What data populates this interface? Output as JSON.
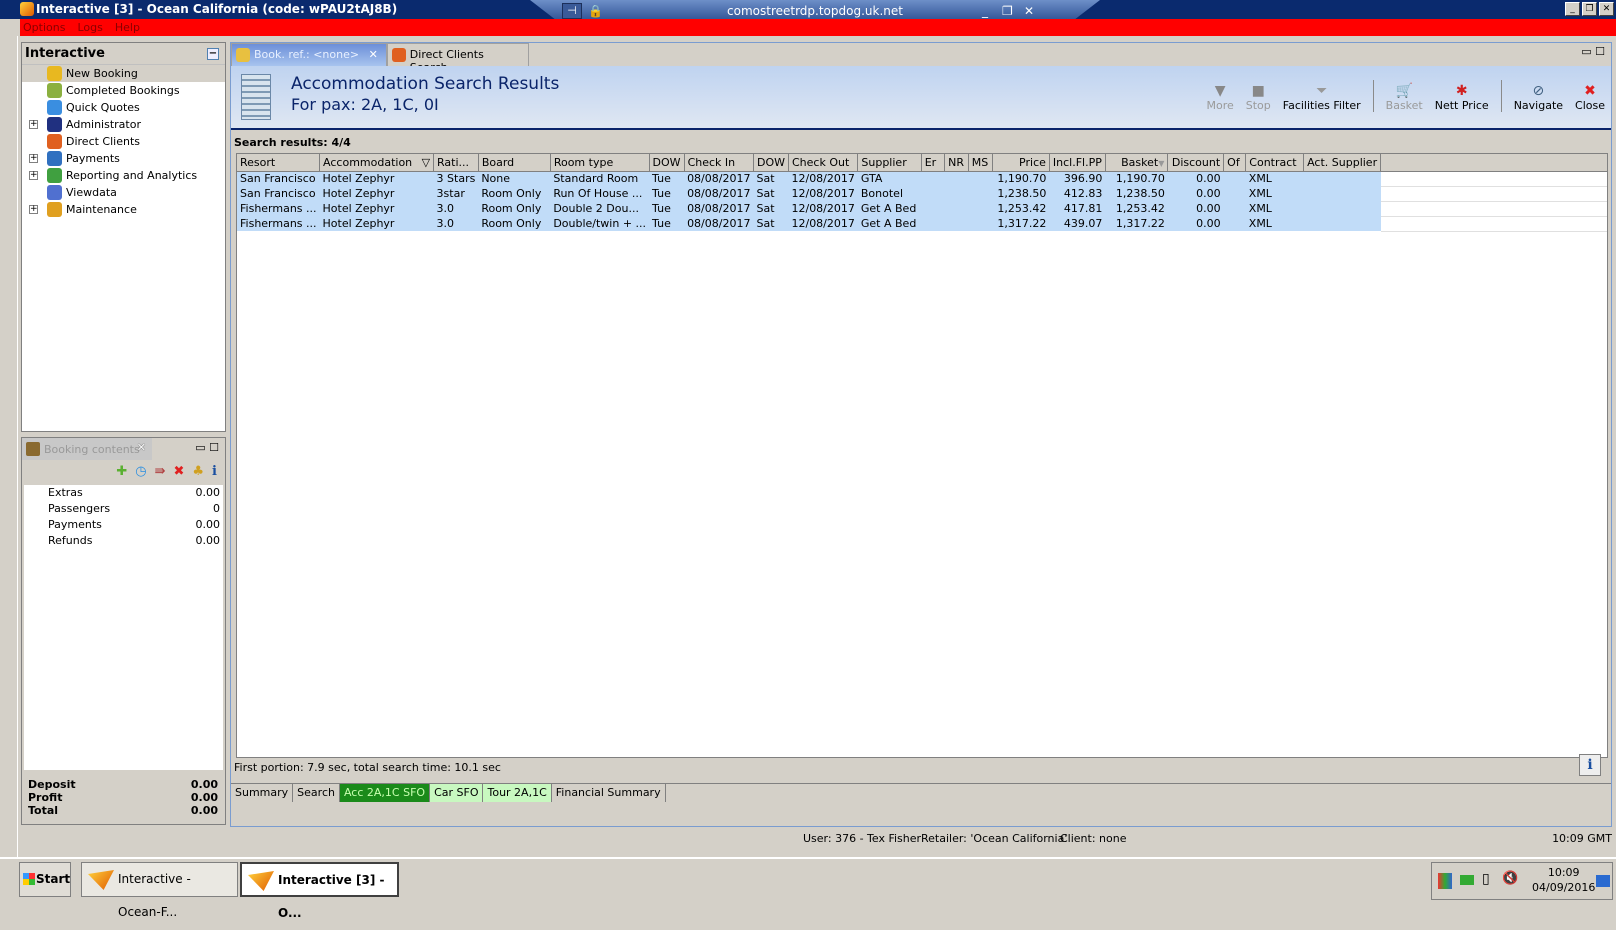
{
  "window": {
    "title": "Interactive [3] - Ocean California (code: wPAU2tAJ8B)",
    "rdp_host": "comostreetrdp.topdog.uk.net"
  },
  "menu": [
    "Options",
    "Logs",
    "Help"
  ],
  "nav": {
    "title": "Interactive",
    "items": [
      {
        "label": "New Booking",
        "expandable": false,
        "selected": true,
        "icon": "palm-tree-icon",
        "color": "#e8b820"
      },
      {
        "label": "Completed Bookings",
        "expandable": false,
        "icon": "palm-money-icon",
        "color": "#8bb040"
      },
      {
        "label": "Quick Quotes",
        "expandable": false,
        "icon": "clock-icon",
        "color": "#3a8ee0"
      },
      {
        "label": "Administrator",
        "expandable": true,
        "icon": "runner-icon",
        "color": "#203080"
      },
      {
        "label": "Direct Clients",
        "expandable": false,
        "icon": "person-icon",
        "color": "#e06020"
      },
      {
        "label": "Payments",
        "expandable": true,
        "icon": "money-icon",
        "color": "#3070c0"
      },
      {
        "label": "Reporting and Analytics",
        "expandable": true,
        "icon": "report-icon",
        "color": "#40a040"
      },
      {
        "label": "Viewdata",
        "expandable": false,
        "icon": "globe-icon",
        "color": "#5070d0"
      },
      {
        "label": "Maintenance",
        "expandable": true,
        "icon": "stack-icon",
        "color": "#e0a020"
      }
    ]
  },
  "booking_contents": {
    "tab_label": "Booking contents",
    "rows": [
      {
        "label": "Extras",
        "value": "0.00"
      },
      {
        "label": "Passengers",
        "value": "0"
      },
      {
        "label": "Payments",
        "value": "0.00"
      },
      {
        "label": "Refunds",
        "value": "0.00"
      }
    ],
    "totals": [
      {
        "label": "Deposit",
        "value": "0.00"
      },
      {
        "label": "Profit",
        "value": "0.00"
      },
      {
        "label": "Total",
        "value": "0.00"
      }
    ]
  },
  "tabs": [
    {
      "label": "Book. ref.: <none>",
      "active": true
    },
    {
      "label": "Direct Clients Search",
      "active": false
    }
  ],
  "header": {
    "title": "Accommodation Search Results",
    "subtitle": "For pax: 2A, 1C, 0I"
  },
  "toolbar": [
    {
      "label": "More",
      "icon": "triangle-down-icon",
      "glyph": "▼",
      "enabled": false
    },
    {
      "label": "Stop",
      "icon": "stop-icon",
      "glyph": "■",
      "enabled": false
    },
    {
      "label": "Facilities Filter",
      "icon": "funnel-icon",
      "glyph": "⏷",
      "enabled": true
    },
    {
      "label": "Basket",
      "icon": "basket-icon",
      "glyph": "🛒",
      "enabled": false,
      "sep_before": true
    },
    {
      "label": "Nett Price",
      "icon": "nett-price-icon",
      "glyph": "✱",
      "enabled": true
    },
    {
      "label": "Navigate",
      "icon": "compass-icon",
      "glyph": "⊘",
      "enabled": true,
      "sep_before": true
    },
    {
      "label": "Close",
      "icon": "close-icon",
      "glyph": "✖",
      "enabled": true
    }
  ],
  "results_label": "Search results: 4/4",
  "grid": {
    "columns": [
      "Resort",
      "Accommodation",
      "Rati...",
      "Board",
      "Room type",
      "DOW",
      "Check In",
      "DOW",
      "Check Out",
      "Supplier",
      "Er",
      "NR",
      "MS",
      "Price",
      "Incl.Fl.PP",
      "Basket",
      "Discount",
      "Of",
      "Contract",
      "Act. Supplier"
    ],
    "rows": [
      [
        "San Francisco",
        "Hotel Zephyr",
        "3 Stars",
        "None",
        "Standard Room",
        "Tue",
        "08/08/2017",
        "Sat",
        "12/08/2017",
        "GTA",
        "",
        "",
        "",
        "1,190.70",
        "396.90",
        "1,190.70",
        "0.00",
        "",
        "XML",
        ""
      ],
      [
        "San Francisco",
        "Hotel Zephyr",
        "3star",
        "Room Only",
        "Run Of House ...",
        "Tue",
        "08/08/2017",
        "Sat",
        "12/08/2017",
        "Bonotel",
        "",
        "",
        "",
        "1,238.50",
        "412.83",
        "1,238.50",
        "0.00",
        "",
        "XML",
        ""
      ],
      [
        "Fishermans ...",
        "Hotel Zephyr",
        "3.0",
        "Room Only",
        "Double 2  Dou...",
        "Tue",
        "08/08/2017",
        "Sat",
        "12/08/2017",
        "Get A Bed",
        "",
        "",
        "",
        "1,253.42",
        "417.81",
        "1,253.42",
        "0.00",
        "",
        "XML",
        ""
      ],
      [
        "Fishermans ...",
        "Hotel Zephyr",
        "3.0",
        "Room Only",
        "Double/twin + ...",
        "Tue",
        "08/08/2017",
        "Sat",
        "12/08/2017",
        "Get A Bed",
        "",
        "",
        "",
        "1,317.22",
        "439.07",
        "1,317.22",
        "0.00",
        "",
        "XML",
        ""
      ]
    ]
  },
  "search_time": "First portion: 7.9 sec, total search time: 10.1 sec",
  "bottom_tabs": [
    {
      "label": "Summary",
      "style": ""
    },
    {
      "label": "Search",
      "style": ""
    },
    {
      "label": "Acc 2A,1C SFO",
      "style": "on"
    },
    {
      "label": "Car SFO",
      "style": "lt"
    },
    {
      "label": "Tour 2A,1C",
      "style": "lt"
    },
    {
      "label": "Financial Summary",
      "style": ""
    }
  ],
  "status": {
    "user": "User: 376 - Tex Fisher",
    "retailer": "Retailer: 'Ocean California'",
    "client": "Client: none",
    "time": "10:09 GMT"
  },
  "taskbar": {
    "start": "Start",
    "tasks": [
      {
        "label": "Interactive - Ocean-F...",
        "active": false
      },
      {
        "label": "Interactive [3] - O...",
        "active": true
      }
    ],
    "clock_time": "10:09",
    "clock_date": "04/09/2016"
  }
}
